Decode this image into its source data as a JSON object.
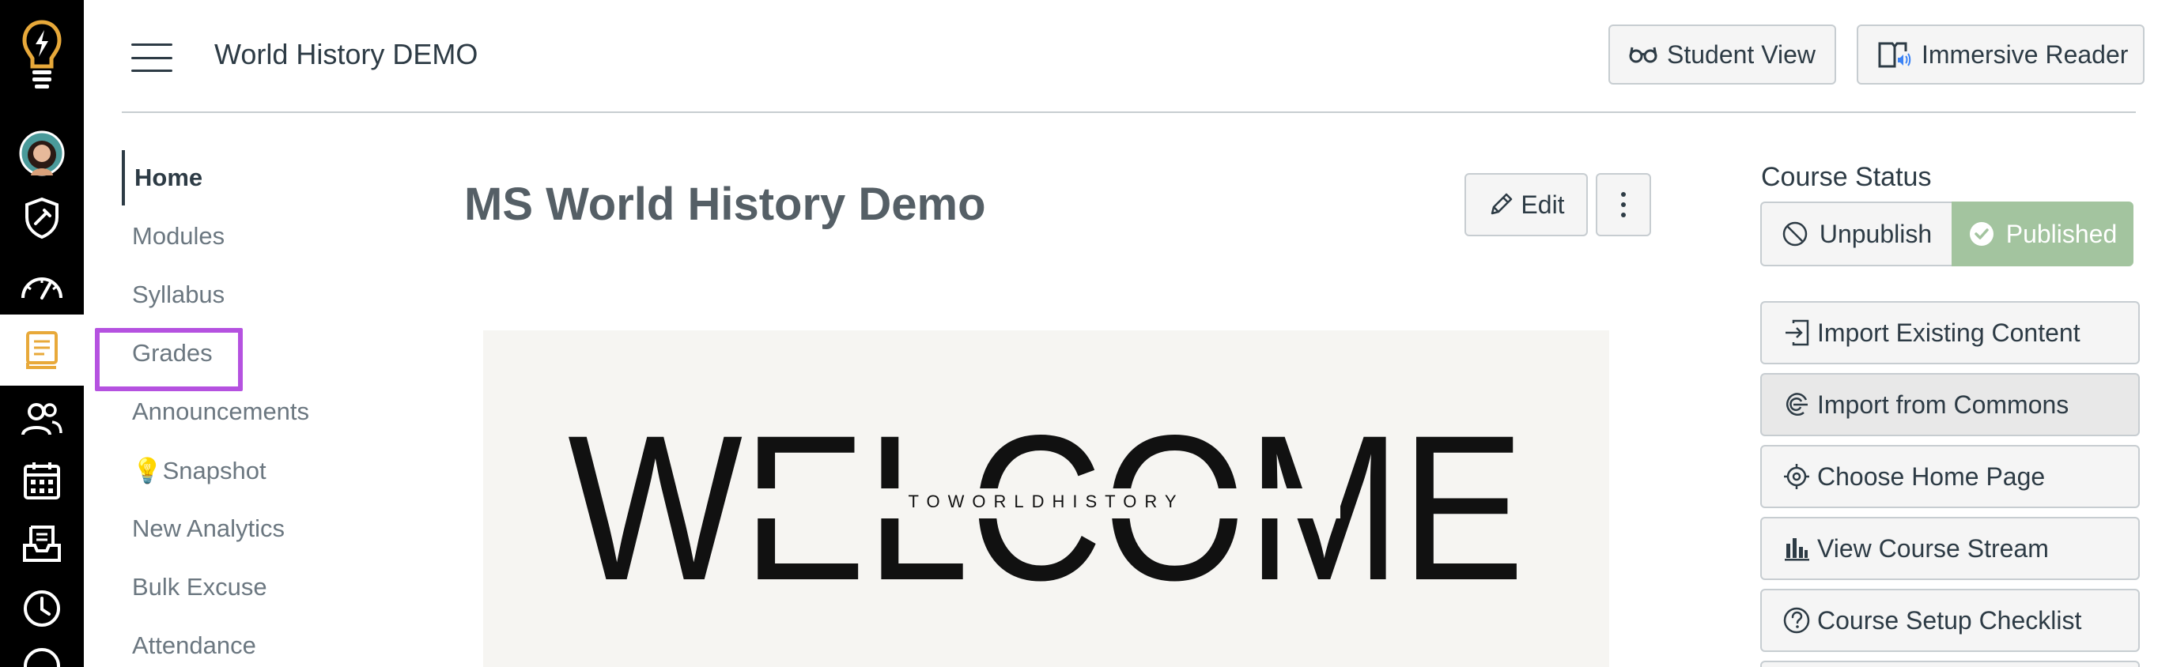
{
  "header": {
    "course_title": "World History DEMO",
    "student_view_label": "Student View",
    "immersive_reader_label": "Immersive Reader"
  },
  "global_nav": {
    "items": [
      {
        "icon": "lightbulb-logo-icon"
      },
      {
        "icon": "avatar"
      },
      {
        "icon": "admin-shield-icon"
      },
      {
        "icon": "dashboard-gauge-icon"
      },
      {
        "icon": "courses-book-icon",
        "active": true
      },
      {
        "icon": "groups-people-icon"
      },
      {
        "icon": "calendar-icon"
      },
      {
        "icon": "inbox-icon"
      },
      {
        "icon": "history-clock-icon"
      },
      {
        "icon": "help-icon"
      }
    ]
  },
  "course_nav": {
    "items": [
      {
        "label": "Home",
        "active": true
      },
      {
        "label": "Modules"
      },
      {
        "label": "Syllabus"
      },
      {
        "label": "Grades",
        "highlighted": true
      },
      {
        "label": "Announcements"
      },
      {
        "label": "💡Snapshot"
      },
      {
        "label": "New Analytics"
      },
      {
        "label": "Bulk Excuse"
      },
      {
        "label": "Attendance"
      }
    ]
  },
  "main": {
    "page_title": "MS World History Demo",
    "edit_label": "Edit",
    "banner": {
      "headline": "WELCOME",
      "subtitle": "TOWORLDHISTORY"
    }
  },
  "sidebar": {
    "course_status_title": "Course Status",
    "unpublish_label": "Unpublish",
    "published_label": "Published",
    "buttons": [
      {
        "label": "Import Existing Content",
        "icon": "import-icon"
      },
      {
        "label": "Import from Commons",
        "icon": "commons-icon"
      },
      {
        "label": "Choose Home Page",
        "icon": "target-icon"
      },
      {
        "label": "View Course Stream",
        "icon": "bar-chart-icon"
      },
      {
        "label": "Course Setup Checklist",
        "icon": "question-circle-icon"
      }
    ]
  },
  "colors": {
    "global_nav_bg": "#000000",
    "active_icon": "#e8a93a",
    "published_bg": "#a3c49f",
    "highlight": "#b552e0"
  }
}
